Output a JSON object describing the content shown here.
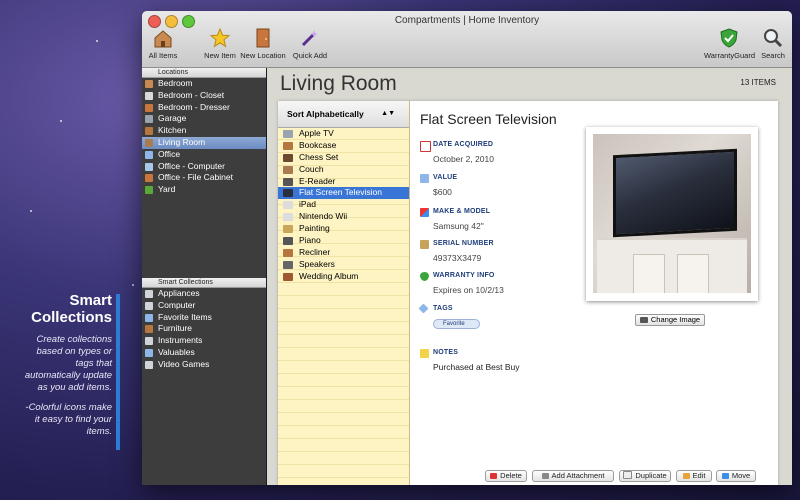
{
  "promo": {
    "title": "Smart Collections",
    "text1": "Create collections based on types or tags that automatically update as you add items.",
    "text2": "-Colorful icons make it easy to find your items."
  },
  "window": {
    "title": "Compartments | Home Inventory"
  },
  "toolbar": {
    "all_items": "All Items",
    "new_item": "New Item",
    "new_location": "New Location",
    "quick_add": "Quick Add",
    "warranty_guard": "WarrantyGuard",
    "search": "Search"
  },
  "sidebar": {
    "locations_header": "Locations",
    "locations": [
      {
        "label": "Bedroom",
        "icon": "house-icon",
        "color": "#c98a52"
      },
      {
        "label": "Bedroom - Closet",
        "icon": "door-icon",
        "color": "#d9d9d9"
      },
      {
        "label": "Bedroom - Dresser",
        "icon": "dresser-icon",
        "color": "#c8763e"
      },
      {
        "label": "Garage",
        "icon": "garage-icon",
        "color": "#9aa3b0"
      },
      {
        "label": "Kitchen",
        "icon": "kitchen-icon",
        "color": "#b5773f"
      },
      {
        "label": "Living Room",
        "icon": "sofa-icon",
        "color": "#a97b52"
      },
      {
        "label": "Office",
        "icon": "globe-icon",
        "color": "#8fb6e8"
      },
      {
        "label": "Office - Computer",
        "icon": "computer-icon",
        "color": "#a8c6e8"
      },
      {
        "label": "Office - File Cabinet",
        "icon": "cabinet-icon",
        "color": "#c8763e"
      },
      {
        "label": "Yard",
        "icon": "leaf-icon",
        "color": "#59a83a"
      }
    ],
    "smart_header": "Smart Collections",
    "smart": [
      {
        "label": "Appliances",
        "icon": "gear-icon",
        "color": "#cfd4da"
      },
      {
        "label": "Computer",
        "icon": "gear-icon",
        "color": "#cfd4da"
      },
      {
        "label": "Favorite Items",
        "icon": "tag-icon",
        "color": "#8fb6e8"
      },
      {
        "label": "Furniture",
        "icon": "chair-icon",
        "color": "#b5773f"
      },
      {
        "label": "Instruments",
        "icon": "gear-icon",
        "color": "#cfd4da"
      },
      {
        "label": "Valuables",
        "icon": "tag-icon",
        "color": "#8fb6e8"
      },
      {
        "label": "Video Games",
        "icon": "gear-icon",
        "color": "#cfd4da"
      }
    ]
  },
  "main": {
    "room_title": "Living Room",
    "count": "13 ITEMS",
    "sort_label": "Sort Alphabetically",
    "sort_arrows": "▲▼",
    "items": [
      {
        "label": "Apple TV",
        "color": "#9aa3b0"
      },
      {
        "label": "Bookcase",
        "color": "#b5773f"
      },
      {
        "label": "Chess Set",
        "color": "#6b4a2e"
      },
      {
        "label": "Couch",
        "color": "#a97b52"
      },
      {
        "label": "E-Reader",
        "color": "#555555"
      },
      {
        "label": "Flat Screen Television",
        "color": "#2a2f3d"
      },
      {
        "label": "iPad",
        "color": "#dddddd"
      },
      {
        "label": "Nintendo Wii",
        "color": "#dddddd"
      },
      {
        "label": "Painting",
        "color": "#c9a65a"
      },
      {
        "label": "Piano",
        "color": "#555555"
      },
      {
        "label": "Recliner",
        "color": "#b5773f"
      },
      {
        "label": "Speakers",
        "color": "#666666"
      },
      {
        "label": "Wedding Album",
        "color": "#a0582e"
      }
    ],
    "selected_index": 5
  },
  "detail": {
    "title": "Flat Screen Television",
    "date_label": "DATE ACQUIRED",
    "date_value": "October 2, 2010",
    "value_label": "VALUE",
    "value_value": "$600",
    "make_label": "MAKE & MODEL",
    "make_value": "Samsung 42\"",
    "serial_label": "SERIAL NUMBER",
    "serial_value": "49373X3479",
    "warranty_label": "WARRANTY INFO",
    "warranty_value": "Expires on 10/2/13",
    "tags_label": "TAGS",
    "tag": "Favorite",
    "notes_label": "NOTES",
    "notes_value": "Purchased at Best Buy",
    "change_image": "Change Image"
  },
  "actions": {
    "delete": "Delete",
    "add_attachment": "Add Attachment",
    "duplicate": "Duplicate",
    "edit": "Edit",
    "move": "Move"
  }
}
